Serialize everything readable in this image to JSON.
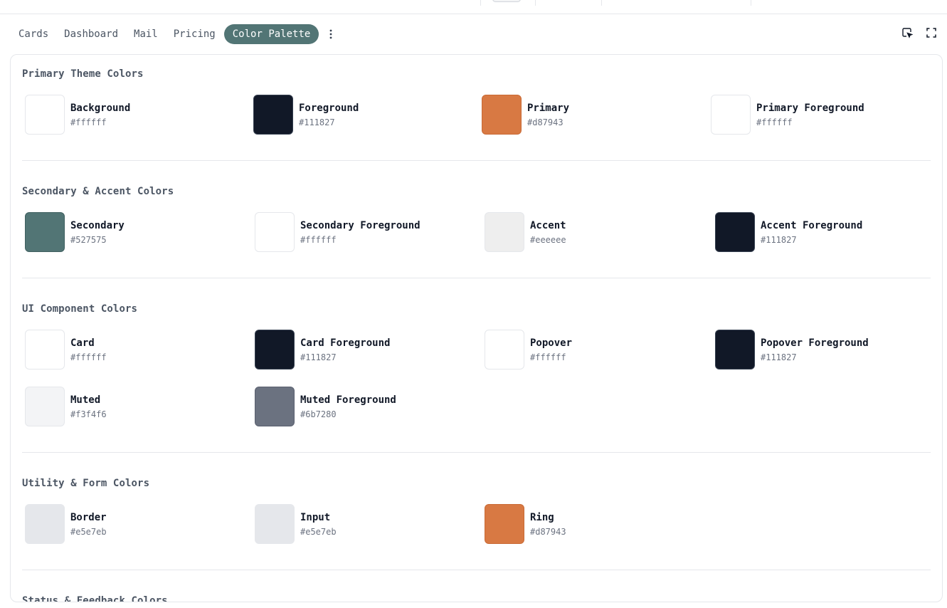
{
  "tabs": [
    {
      "label": "Cards",
      "active": false
    },
    {
      "label": "Dashboard",
      "active": false
    },
    {
      "label": "Mail",
      "active": false
    },
    {
      "label": "Pricing",
      "active": false
    },
    {
      "label": "Color Palette",
      "active": true
    }
  ],
  "icons": {
    "more": "more-vertical-icon",
    "inspect": "cursor-select-icon",
    "fullscreen": "fullscreen-icon"
  },
  "sections": [
    {
      "title": "Primary Theme Colors",
      "colors": [
        {
          "name": "Background",
          "hex": "#ffffff"
        },
        {
          "name": "Foreground",
          "hex": "#111827"
        },
        {
          "name": "Primary",
          "hex": "#d87943"
        },
        {
          "name": "Primary Foreground",
          "hex": "#ffffff"
        }
      ]
    },
    {
      "title": "Secondary & Accent Colors",
      "colors": [
        {
          "name": "Secondary",
          "hex": "#527575"
        },
        {
          "name": "Secondary Foreground",
          "hex": "#ffffff"
        },
        {
          "name": "Accent",
          "hex": "#eeeeee"
        },
        {
          "name": "Accent Foreground",
          "hex": "#111827"
        }
      ]
    },
    {
      "title": "UI Component Colors",
      "colors": [
        {
          "name": "Card",
          "hex": "#ffffff"
        },
        {
          "name": "Card Foreground",
          "hex": "#111827"
        },
        {
          "name": "Popover",
          "hex": "#ffffff"
        },
        {
          "name": "Popover Foreground",
          "hex": "#111827"
        },
        {
          "name": "Muted",
          "hex": "#f3f4f6"
        },
        {
          "name": "Muted Foreground",
          "hex": "#6b7280"
        }
      ]
    },
    {
      "title": "Utility & Form Colors",
      "colors": [
        {
          "name": "Border",
          "hex": "#e5e7eb"
        },
        {
          "name": "Input",
          "hex": "#e5e7eb"
        },
        {
          "name": "Ring",
          "hex": "#d87943"
        }
      ]
    },
    {
      "title": "Status & Feedback Colors",
      "colors": []
    }
  ]
}
